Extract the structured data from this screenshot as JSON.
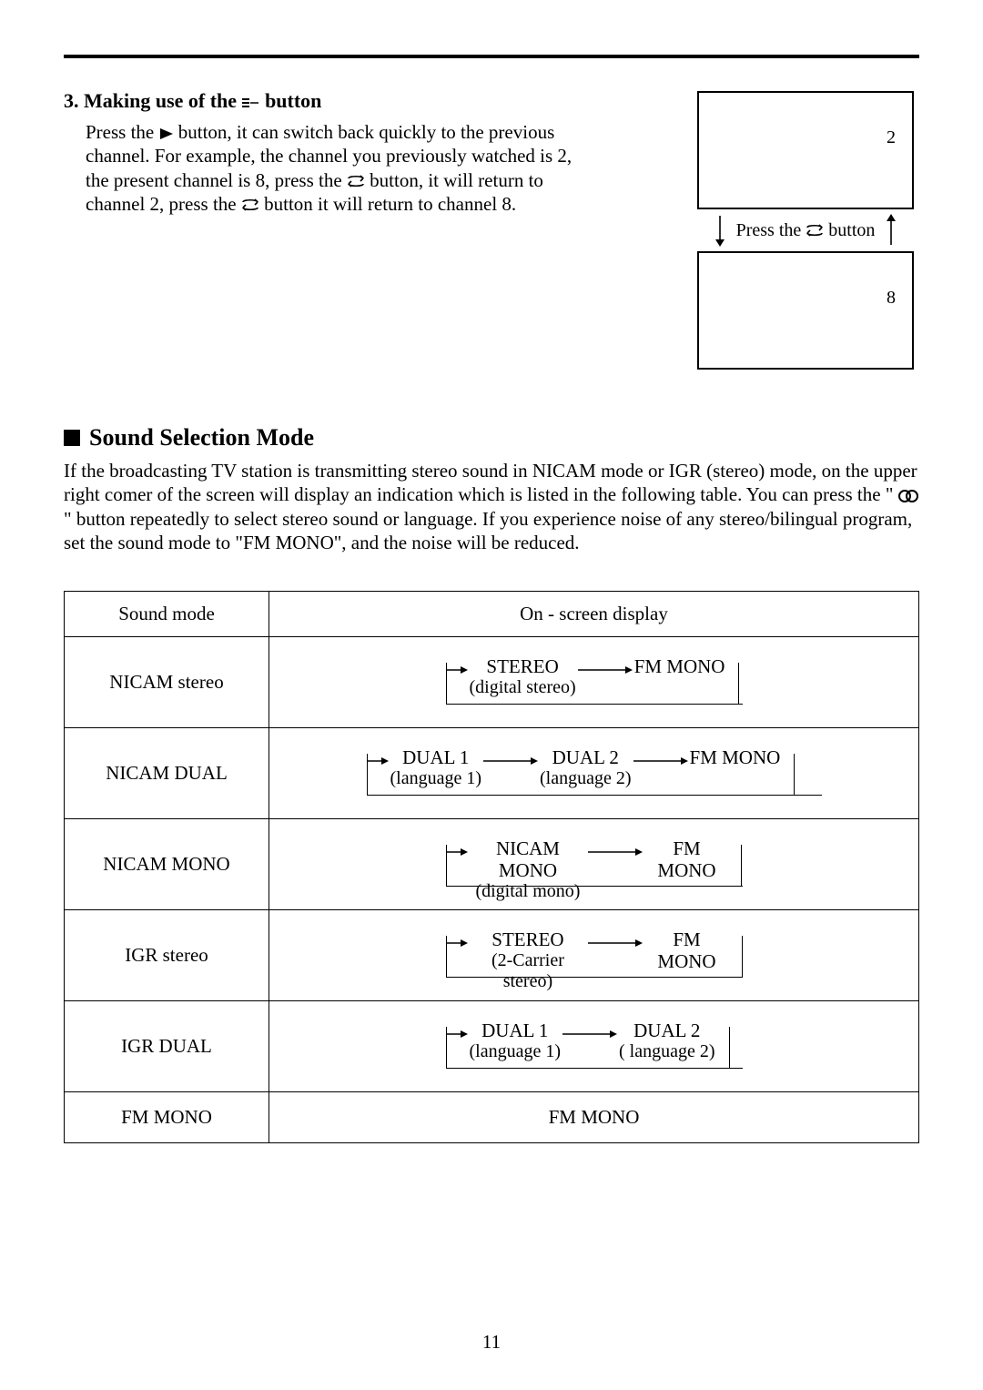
{
  "section3": {
    "heading_prefix": "3. Making use of the ",
    "heading_suffix": " button",
    "body_parts": {
      "p1": "Press the ",
      "p2": " button, it can switch back quickly to the previous channel. For example, the channel you previously watched is 2, the present channel is 8, press the ",
      "p3": " button, it will return to channel 2, press the ",
      "p4": " button it will return to channel 8."
    },
    "diagram": {
      "top_channel": "2",
      "press_label": "Press the ",
      "press_suffix": " button",
      "bottom_channel": "8"
    }
  },
  "sound_section": {
    "heading": "Sound Selection Mode",
    "body_p1": "If the broadcasting TV station is transmitting stereo sound in NICAM mode or IGR (stereo) mode, on the upper right comer of the screen will display an indication which is listed in the following table. You can press the \" ",
    "body_p2": " \" button repeatedly to select stereo sound or language. If you experience noise of any stereo/bilingual program, set the sound mode to \"FM MONO\", and the noise will be reduced."
  },
  "table": {
    "headers": {
      "mode": "Sound mode",
      "display": "On - screen display"
    },
    "rows": [
      {
        "mode": "NICAM stereo",
        "items": [
          {
            "label": "STEREO",
            "sub": "(digital stereo)"
          },
          {
            "label": "FM MONO",
            "sub": ""
          }
        ]
      },
      {
        "mode": "NICAM DUAL",
        "items": [
          {
            "label": "DUAL 1",
            "sub": "(language 1)"
          },
          {
            "label": "DUAL 2",
            "sub": "(language 2)"
          },
          {
            "label": "FM MONO",
            "sub": ""
          }
        ]
      },
      {
        "mode": "NICAM  MONO",
        "items": [
          {
            "label": "NICAM MONO",
            "sub": "(digital mono)"
          },
          {
            "label": "FM MONO",
            "sub": ""
          }
        ]
      },
      {
        "mode": "IGR stereo",
        "items": [
          {
            "label": "STEREO",
            "sub": "(2-Carrier stereo)"
          },
          {
            "label": "FM MONO",
            "sub": ""
          }
        ]
      },
      {
        "mode": "IGR DUAL",
        "items": [
          {
            "label": "DUAL 1",
            "sub": "(language 1)"
          },
          {
            "label": "DUAL 2",
            "sub": "( language 2)"
          }
        ]
      },
      {
        "mode": "FM MONO",
        "single": "FM MONO"
      }
    ]
  },
  "page_number": "11"
}
